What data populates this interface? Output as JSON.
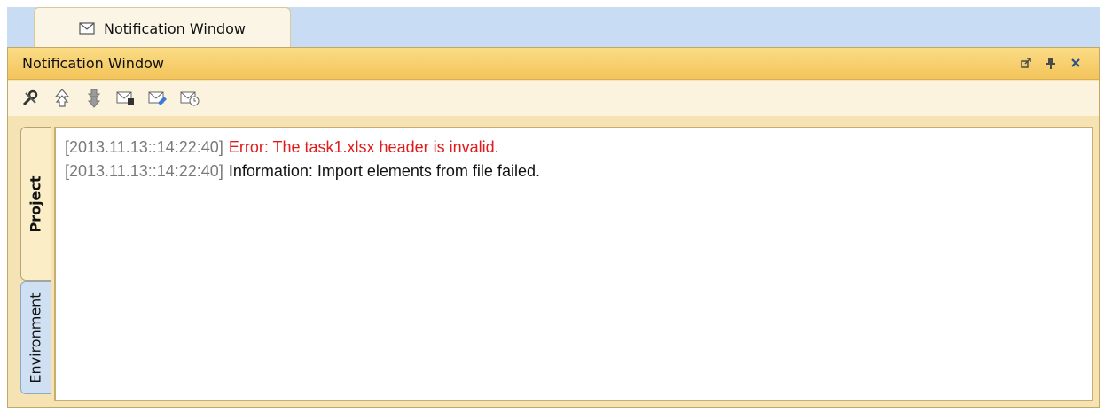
{
  "tabbar": {
    "tabs": [
      {
        "label": "Notification Window",
        "icon": "envelope-icon"
      }
    ]
  },
  "window": {
    "title": "Notification Window",
    "controls": [
      "undock-icon",
      "pin-icon",
      "close-icon"
    ]
  },
  "toolbar": {
    "buttons": [
      "options-icon",
      "previous-icon",
      "next-icon",
      "mark-read-icon",
      "mark-all-read-icon",
      "delayed-icon"
    ]
  },
  "side_tabs": {
    "project_label": "Project",
    "environment_label": "Environment"
  },
  "log": {
    "lines": [
      {
        "timestamp": "[2013.11.13::14:22:40]",
        "message": "Error: The task1.xlsx header is invalid.",
        "level": "error"
      },
      {
        "timestamp": "[2013.11.13::14:22:40]",
        "message": "Information: Import elements from file failed.",
        "level": "info"
      }
    ]
  },
  "colors": {
    "title_bar": "#f3c45a",
    "error_text": "#e01b1b",
    "timestamp_text": "#7a7a7a",
    "tab_strip": "#c8ddf4"
  }
}
